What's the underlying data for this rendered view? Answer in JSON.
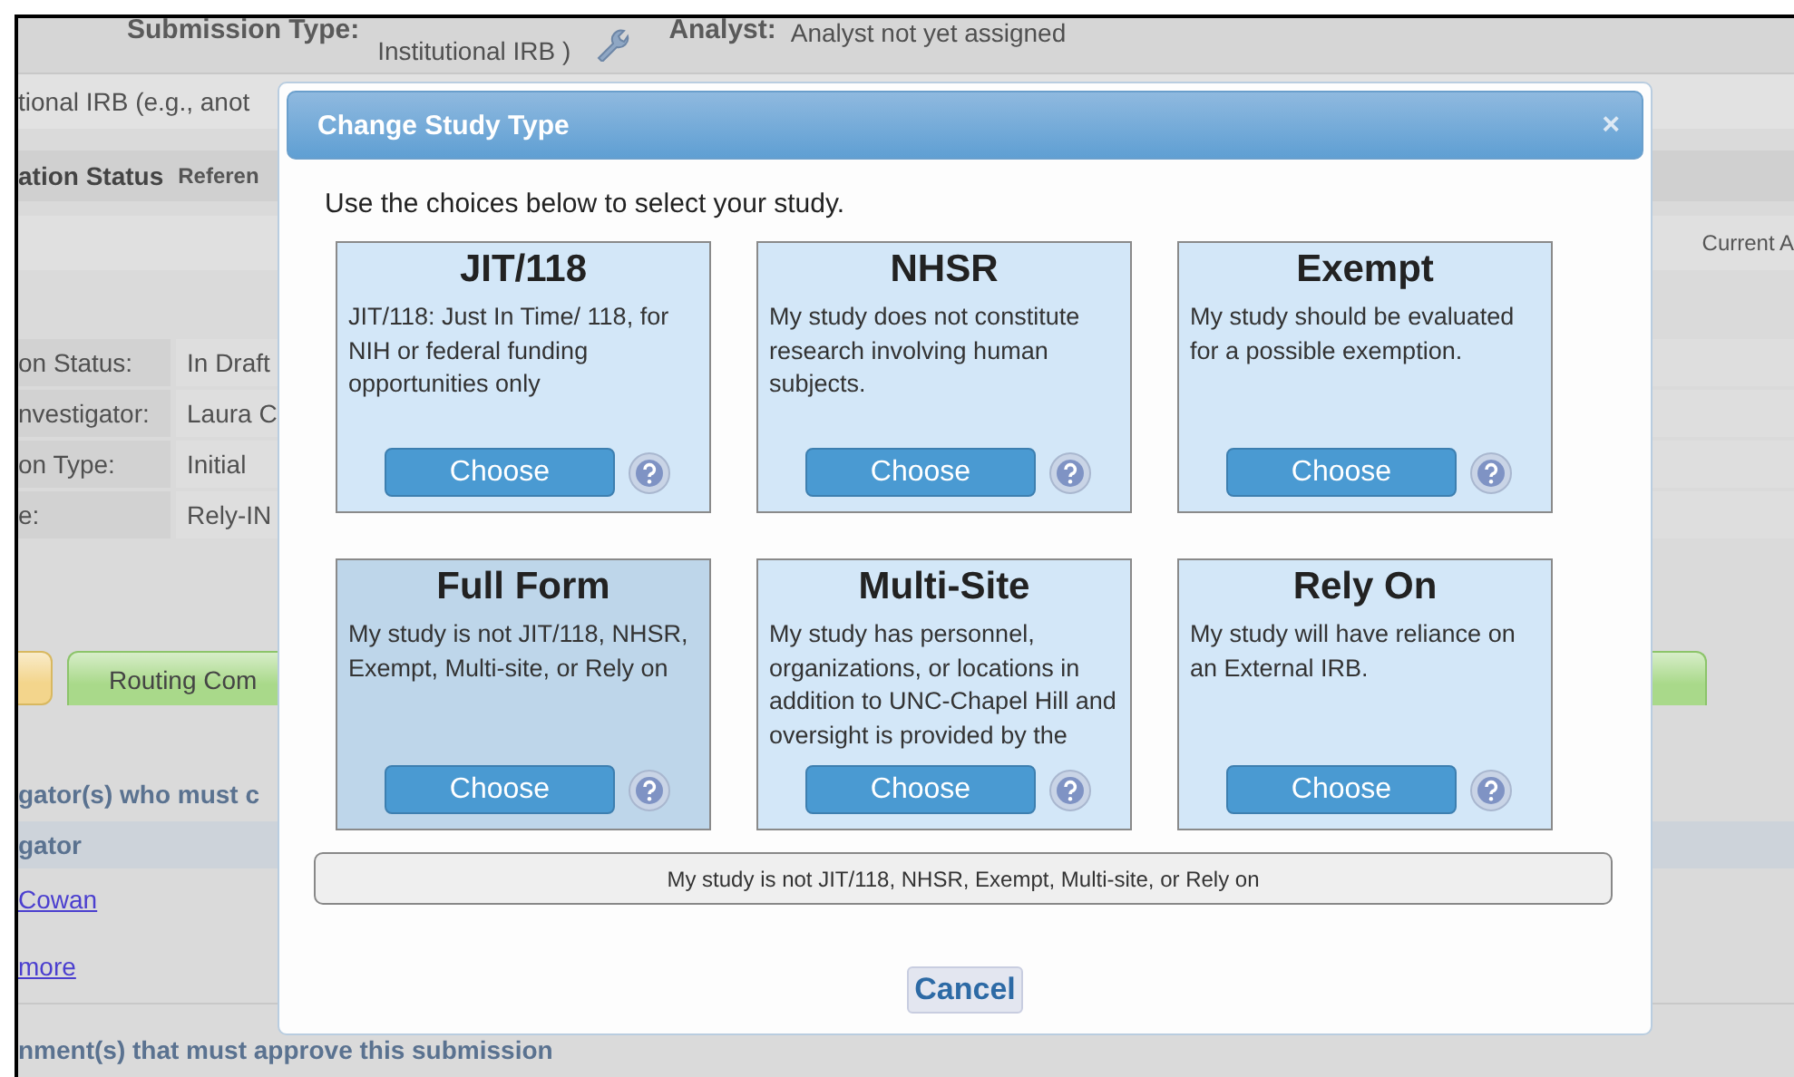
{
  "page": {
    "submission_type_label": "Submission Type:",
    "submission_type_value": "Institutional IRB )",
    "analyst_label": "Analyst:",
    "analyst_value": "Analyst not yet assigned",
    "note": "tional IRB (e.g., anot",
    "section_title": "ation Status",
    "section_tab": "Referen",
    "column_header": "Current A",
    "details": [
      {
        "label": "on Status:",
        "value": "In Draft"
      },
      {
        "label": "nvestigator:",
        "value": "Laura C"
      },
      {
        "label": "on Type:",
        "value": "Initial"
      },
      {
        "label": "e:",
        "value": "Rely-IN"
      }
    ],
    "tabs": [
      {
        "color": "#f3d58c"
      },
      {
        "label": "Routing Com",
        "color": "#a9d98a"
      }
    ],
    "investigators_heading": "gator(s) who must c",
    "investigators_column": "gator",
    "investigator_link": "Cowan",
    "more_link": "more",
    "departments_heading": "nment(s) that must approve this submission"
  },
  "dialog": {
    "title": "Change Study Type",
    "close": "×",
    "intro": "Use the choices below to select your study.",
    "options": [
      {
        "title": "JIT/118",
        "description": "JIT/118: Just In Time/ 118, for NIH or federal funding opportunities only",
        "button": "Choose",
        "selected": false
      },
      {
        "title": "NHSR",
        "description": "My study does not constitute research involving human subjects.",
        "button": "Choose",
        "selected": false
      },
      {
        "title": "Exempt",
        "description": "My study should be evaluated for a possible exemption.",
        "button": "Choose",
        "selected": false
      },
      {
        "title": "Full Form",
        "description": "My study is not JIT/118, NHSR, Exempt, Multi-site, or Rely on",
        "button": "Choose",
        "selected": true
      },
      {
        "title": "Multi-Site",
        "description": "My study has personnel, organizations, or locations in addition to UNC-Chapel Hill and oversight is provided by the",
        "button": "Choose",
        "selected": false
      },
      {
        "title": "Rely On",
        "description": "My study will have reliance on an External IRB.",
        "button": "Choose",
        "selected": false
      }
    ],
    "summary": "My study is not JIT/118, NHSR, Exempt, Multi-site, or Rely on",
    "cancel": "Cancel"
  }
}
